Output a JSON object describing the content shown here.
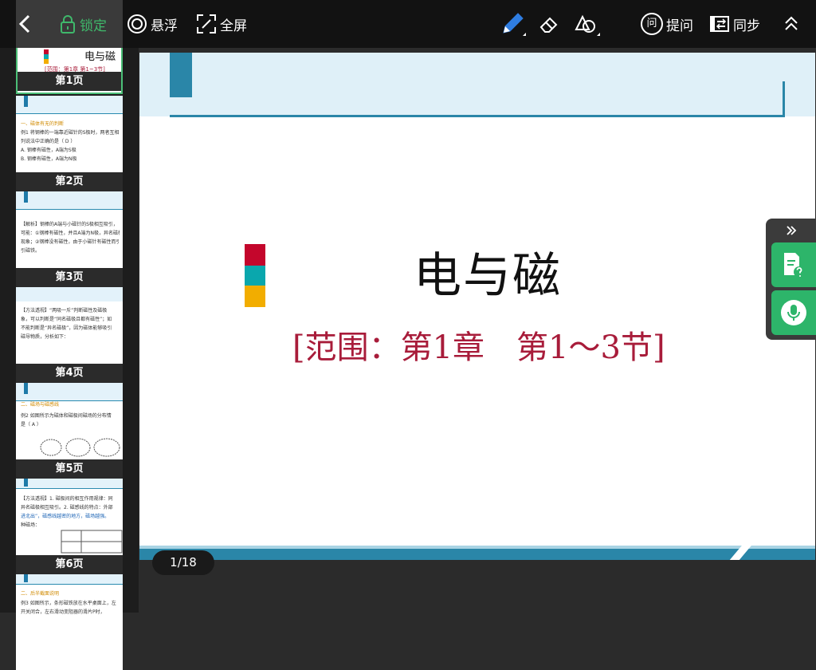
{
  "toolbar": {
    "lock_label": "锁定",
    "float_label": "悬浮",
    "fullscreen_label": "全屏",
    "ask_label": "提问",
    "ask_icon_text": "问",
    "sync_label": "同步"
  },
  "colors": {
    "toolbar_bg": "#121212",
    "lock_green": "#3fb86b",
    "slide_accent": "#2a86a8",
    "title_red": "#a81c3a",
    "panel_green": "#2db56a",
    "pen_blue": "#2f7de1"
  },
  "sidebar": {
    "thumbnails": [
      {
        "page_label": "第1页",
        "title": "电与磁",
        "subtitle": "[范围：第1章 第1~3节]"
      },
      {
        "page_label": "第2页",
        "lines": [
          "一、磁体有无的判断",
          "例1 将钢棒的一端靠近磁针的S极时，两者互相",
          "列说法中正确的是（ D ）",
          "A. 钢棒有磁性，A端为S极",
          "B. 钢棒有磁性，A端为N极"
        ]
      },
      {
        "page_label": "第3页",
        "lines": [
          "【解析】钢棒的A端与小磁针的S极相互吸引，",
          "可能：①钢棒有磁性，并且A端为N极，异名磁极",
          "现象；②钢棒没有磁性，由于小磁针有磁性而引",
          "引磁铁。"
        ]
      },
      {
        "page_label": "第4页",
        "lines": [
          "【方法透视】“两吸一斥”判断磁性及磁极",
          "象，可以判断是“同名磁极且都有磁性”；如",
          "不能判断是“异名磁极”，因为磁体能够吸引",
          "磁导物质，分析如下："
        ]
      },
      {
        "page_label": "第5页",
        "lines": [
          "二、磁场与磁感线",
          "例2 如图所示为磁体和磁极间磁场的分布情",
          "是（ A ）"
        ]
      },
      {
        "page_label": "第6页",
        "lines": [
          "【方法透视】1. 磁极间的相互作用规律：同",
          "异名磁极相互吸引。2. 磁感线的特点：外部",
          "进北出”，磁感线越密的地方，磁场越强。",
          "种磁场："
        ]
      },
      {
        "page_label": "",
        "lines": [
          "二、后半截面说明",
          "例3 如图所示，条形磁铁放在水平桌面上，左",
          "开关闭合，左右滑动变阻器的滑片P时，"
        ]
      }
    ]
  },
  "slide": {
    "title": "电与磁",
    "subtitle": "[范围：第1章　第1～3节]"
  },
  "pagination": {
    "text": "1/18",
    "current": 1,
    "total": 18
  }
}
